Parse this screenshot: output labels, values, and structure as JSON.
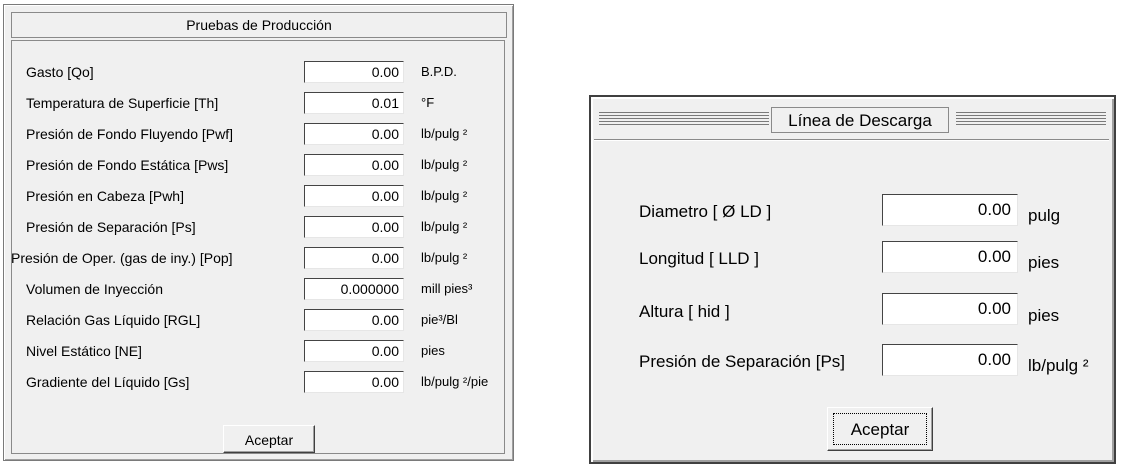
{
  "produccion": {
    "title": "Pruebas de Producción",
    "rows": [
      {
        "label": "Gasto  [Qo]",
        "value": "0.00",
        "unit": "B.P.D."
      },
      {
        "label": "Temperatura de Superficie  [Th]",
        "value": "0.01",
        "unit": "°F"
      },
      {
        "label": "Presión de Fondo Fluyendo [Pwf]",
        "value": "0.00",
        "unit": "lb/pulg ²"
      },
      {
        "label": "Presión de Fondo Estática [Pws]",
        "value": "0.00",
        "unit": "lb/pulg ²"
      },
      {
        "label": "Presión en Cabeza [Pwh]",
        "value": "0.00",
        "unit": "lb/pulg ²"
      },
      {
        "label": "Presión de Separación [Ps]",
        "value": "0.00",
        "unit": "lb/pulg ²"
      },
      {
        "label": "Presión de Oper. (gas de iny.)  [Pop]",
        "value": "0.00",
        "unit": "lb/pulg ²"
      },
      {
        "label": "Volumen de Inyección",
        "value": "0.000000",
        "unit": "mill pies³"
      },
      {
        "label": "Relación Gas Líquido [RGL]",
        "value": "0.00",
        "unit": "pie³/Bl"
      },
      {
        "label": "Nivel Estático [NE]",
        "value": "0.00",
        "unit": "pies"
      },
      {
        "label": "Gradiente del Líquido [Gs]",
        "value": "0.00",
        "unit": "lb/pulg ²/pie"
      }
    ],
    "accept_label": "Aceptar"
  },
  "linea": {
    "title": "Línea de Descarga",
    "rows": [
      {
        "label": "Diametro [ Ø LD ]",
        "value": "0.00",
        "unit": "pulg"
      },
      {
        "label": "Longitud [ LLD ]",
        "value": "0.00",
        "unit": "pies"
      },
      {
        "label": "Altura [ hid ]",
        "value": "0.00",
        "unit": "pies"
      },
      {
        "label": "Presión de Separación [Ps]",
        "value": "0.00",
        "unit": "lb/pulg ²"
      }
    ],
    "accept_label": "Aceptar"
  }
}
